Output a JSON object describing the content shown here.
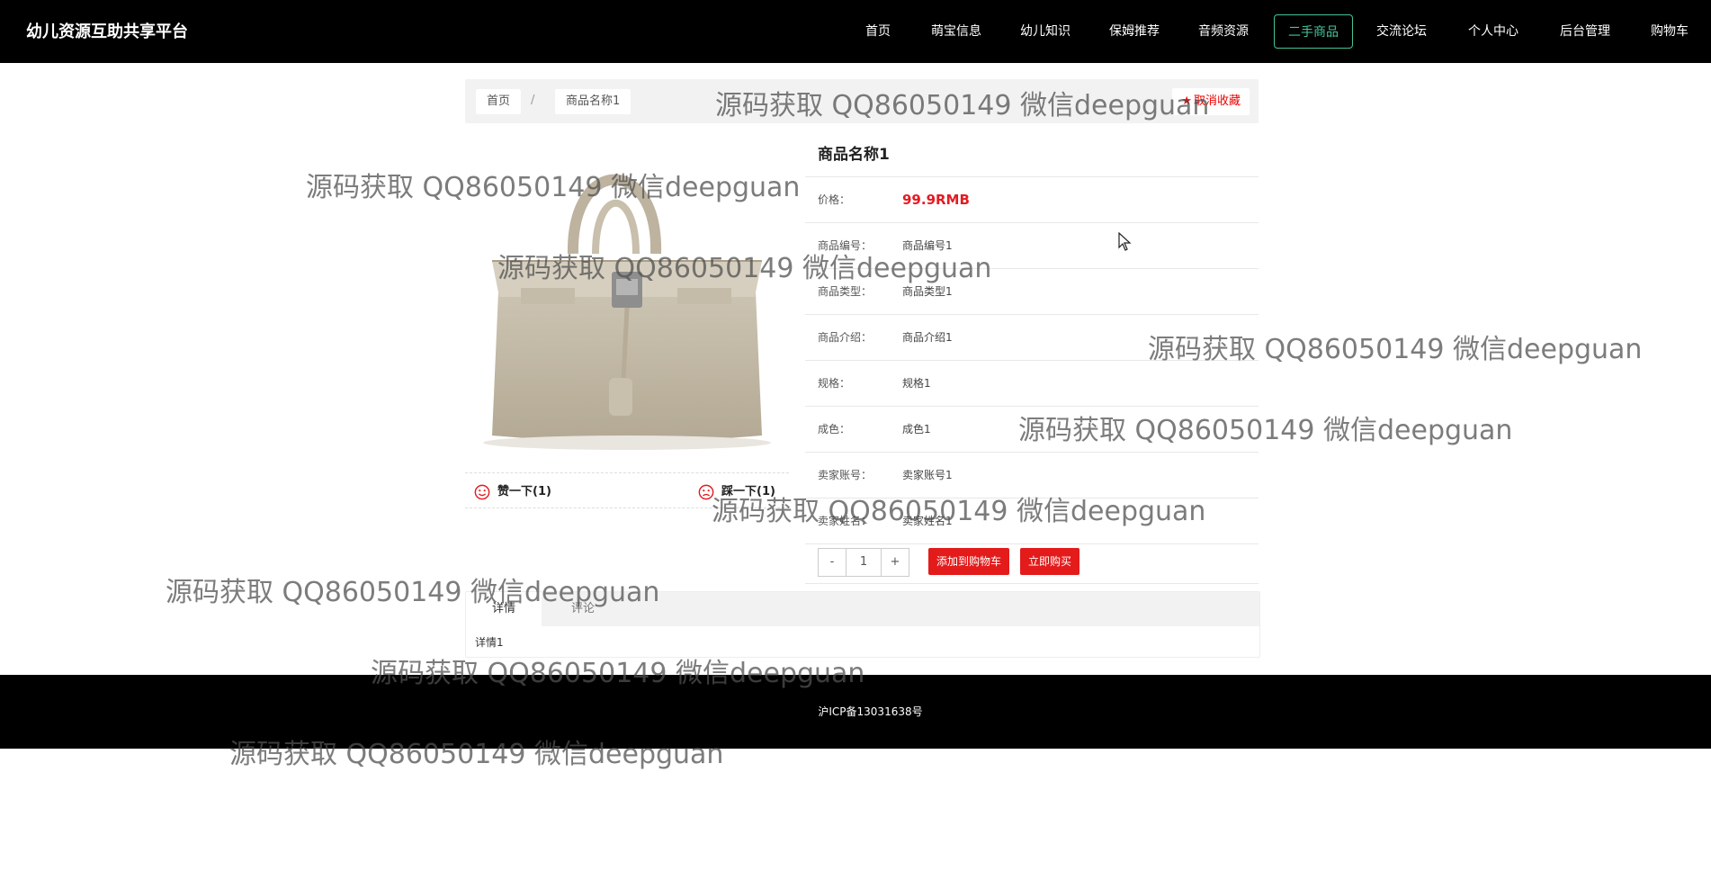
{
  "header": {
    "brand": "幼儿资源互助共享平台",
    "nav": [
      "首页",
      "萌宝信息",
      "幼儿知识",
      "保姆推荐",
      "音频资源",
      "二手商品",
      "交流论坛",
      "个人中心",
      "后台管理",
      "购物车"
    ],
    "active_nav": "二手商品",
    "accent_color": "#47c39b"
  },
  "breadcrumb": {
    "home": "首页",
    "separator": "/",
    "current": "商品名称1",
    "unfavorite_label": "取消收藏"
  },
  "votes": {
    "like": "赞一下(1)",
    "dislike": "踩一下(1)"
  },
  "product": {
    "name": "商品名称1",
    "fields": [
      {
        "key": "价格：",
        "value": "99.9RMB"
      },
      {
        "key": "商品编号：",
        "value": "商品编号1"
      },
      {
        "key": "商品类型：",
        "value": "商品类型1"
      },
      {
        "key": "商品介绍：",
        "value": "商品介绍1"
      },
      {
        "key": "规格：",
        "value": "规格1"
      },
      {
        "key": "成色：",
        "value": "成色1"
      },
      {
        "key": "卖家账号：",
        "value": "卖家账号1"
      },
      {
        "key": "卖家姓名：",
        "value": "卖家姓名1"
      }
    ],
    "price_color": "#e41b23"
  },
  "purchase": {
    "minus": "-",
    "quantity": "1",
    "plus": "+",
    "add_to_cart": "添加到购物车",
    "buy_now": "立即购买"
  },
  "tabs": {
    "items": [
      "详情",
      "评论"
    ],
    "active": "详情",
    "content": "详情1"
  },
  "footer": {
    "icp": "沪ICP备13031638号"
  },
  "watermark": "源码获取 QQ86050149 微信deepguan"
}
